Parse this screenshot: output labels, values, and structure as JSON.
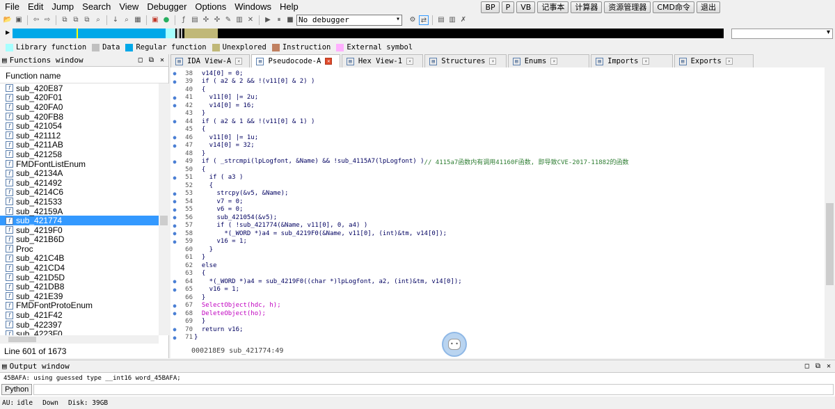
{
  "menu": [
    "File",
    "Edit",
    "Jump",
    "Search",
    "View",
    "Debugger",
    "Options",
    "Windows",
    "Help"
  ],
  "quick_buttons": [
    "BP",
    "P",
    "VB",
    "记事本",
    "计算器",
    "资源管理器",
    "CMD命令",
    "退出"
  ],
  "toolbar": {
    "debugger_select": "No debugger"
  },
  "legend": [
    {
      "label": "Library function",
      "color": "#a6ffff"
    },
    {
      "label": "Data",
      "color": "#c0c0c0"
    },
    {
      "label": "Regular function",
      "color": "#00a8e8"
    },
    {
      "label": "Unexplored",
      "color": "#c0b878"
    },
    {
      "label": "Instruction",
      "color": "#c08060"
    },
    {
      "label": "External symbol",
      "color": "#ffb0ff"
    }
  ],
  "functions_window": {
    "title": "Functions window",
    "header": "Function name",
    "status": "Line 601 of 1673",
    "items": [
      "sub_420E87",
      "sub_420F01",
      "sub_420FA0",
      "sub_420FB8",
      "sub_421054",
      "sub_421112",
      "sub_4211AB",
      "sub_421258",
      "FMDFontListEnum",
      "sub_42134A",
      "sub_421492",
      "sub_4214C6",
      "sub_421533",
      "sub_42159A",
      "sub_421774",
      "sub_4219F0",
      "sub_421B6D",
      "Proc",
      "sub_421C4B",
      "sub_421CD4",
      "sub_421D5D",
      "sub_421DB8",
      "sub_421E39",
      "FMDFontProtoEnum",
      "sub_421F42",
      "sub_422397",
      "sub_4223F0"
    ],
    "selected": "sub_421774"
  },
  "tabs": [
    {
      "label": "IDA View-A",
      "active": false
    },
    {
      "label": "Pseudocode-A",
      "active": true
    },
    {
      "label": "Hex View-1",
      "active": false
    },
    {
      "label": "Structures",
      "active": false
    },
    {
      "label": "Enums",
      "active": false
    },
    {
      "label": "Imports",
      "active": false
    },
    {
      "label": "Exports",
      "active": false
    }
  ],
  "code": {
    "lines": [
      {
        "n": "38",
        "dot": true,
        "text": "  v14[0] = 0;"
      },
      {
        "n": "39",
        "dot": true,
        "text": "  if ( a2 & 2 && !(v11[0] & 2) )"
      },
      {
        "n": "40",
        "dot": false,
        "text": "  {"
      },
      {
        "n": "41",
        "dot": true,
        "text": "    v11[0] |= 2u;"
      },
      {
        "n": "42",
        "dot": true,
        "text": "    v14[0] = 16;"
      },
      {
        "n": "43",
        "dot": false,
        "text": "  }"
      },
      {
        "n": "44",
        "dot": true,
        "text": "  if ( a2 & 1 && !(v11[0] & 1) )"
      },
      {
        "n": "45",
        "dot": false,
        "text": "  {"
      },
      {
        "n": "46",
        "dot": true,
        "text": "    v11[0] |= 1u;"
      },
      {
        "n": "47",
        "dot": true,
        "text": "    v14[0] = 32;"
      },
      {
        "n": "48",
        "dot": false,
        "text": "  }"
      },
      {
        "n": "49",
        "dot": true,
        "text": "  if ( _strcmpi(lpLogfont, &Name) && !sub_4115A7(lpLogfont) )",
        "comment": "// 4115a7函数内有调用41160F函数, 即导致CVE-2017-11882的函数"
      },
      {
        "n": "50",
        "dot": false,
        "text": "  {"
      },
      {
        "n": "51",
        "dot": true,
        "text": "    if ( a3 )"
      },
      {
        "n": "52",
        "dot": false,
        "text": "    {"
      },
      {
        "n": "53",
        "dot": true,
        "text": "      strcpy(&v5, &Name);"
      },
      {
        "n": "54",
        "dot": true,
        "text": "      v7 = 0;"
      },
      {
        "n": "55",
        "dot": true,
        "text": "      v6 = 0;"
      },
      {
        "n": "56",
        "dot": true,
        "text": "      sub_421054(&v5);"
      },
      {
        "n": "57",
        "dot": true,
        "text": "      if ( !sub_421774(&Name, v11[0], 0, a4) )"
      },
      {
        "n": "58",
        "dot": true,
        "text": "        *(_WORD *)a4 = sub_4219F0(&Name, v11[0], (int)&tm, v14[0]);"
      },
      {
        "n": "59",
        "dot": true,
        "text": "      v16 = 1;"
      },
      {
        "n": "60",
        "dot": false,
        "text": "    }"
      },
      {
        "n": "61",
        "dot": false,
        "text": "  }"
      },
      {
        "n": "62",
        "dot": false,
        "text": "  else"
      },
      {
        "n": "63",
        "dot": false,
        "text": "  {"
      },
      {
        "n": "64",
        "dot": true,
        "text": "    *(_WORD *)a4 = sub_4219F0((char *)lpLogfont, a2, (int)&tm, v14[0]);"
      },
      {
        "n": "65",
        "dot": true,
        "text": "    v16 = 1;"
      },
      {
        "n": "66",
        "dot": false,
        "text": "  }"
      },
      {
        "n": "67",
        "dot": true,
        "text": "  SelectObject(hdc, h);",
        "pink": true
      },
      {
        "n": "68",
        "dot": true,
        "text": "  DeleteObject(ho);",
        "pink": true
      },
      {
        "n": "69",
        "dot": false,
        "text": "  }"
      },
      {
        "n": "70",
        "dot": true,
        "text": "  return v16;"
      },
      {
        "n": "71",
        "dot": true,
        "text": "}"
      }
    ],
    "status": "000218E9 sub_421774:49"
  },
  "output_window": {
    "title": "Output window",
    "text": "45BAFA: using guessed type __int16 word_45BAFA;",
    "python_label": "Python"
  },
  "statusbar": {
    "au": "AU:",
    "state": "idle",
    "direction": "Down",
    "disk": "Disk: 39GB"
  }
}
